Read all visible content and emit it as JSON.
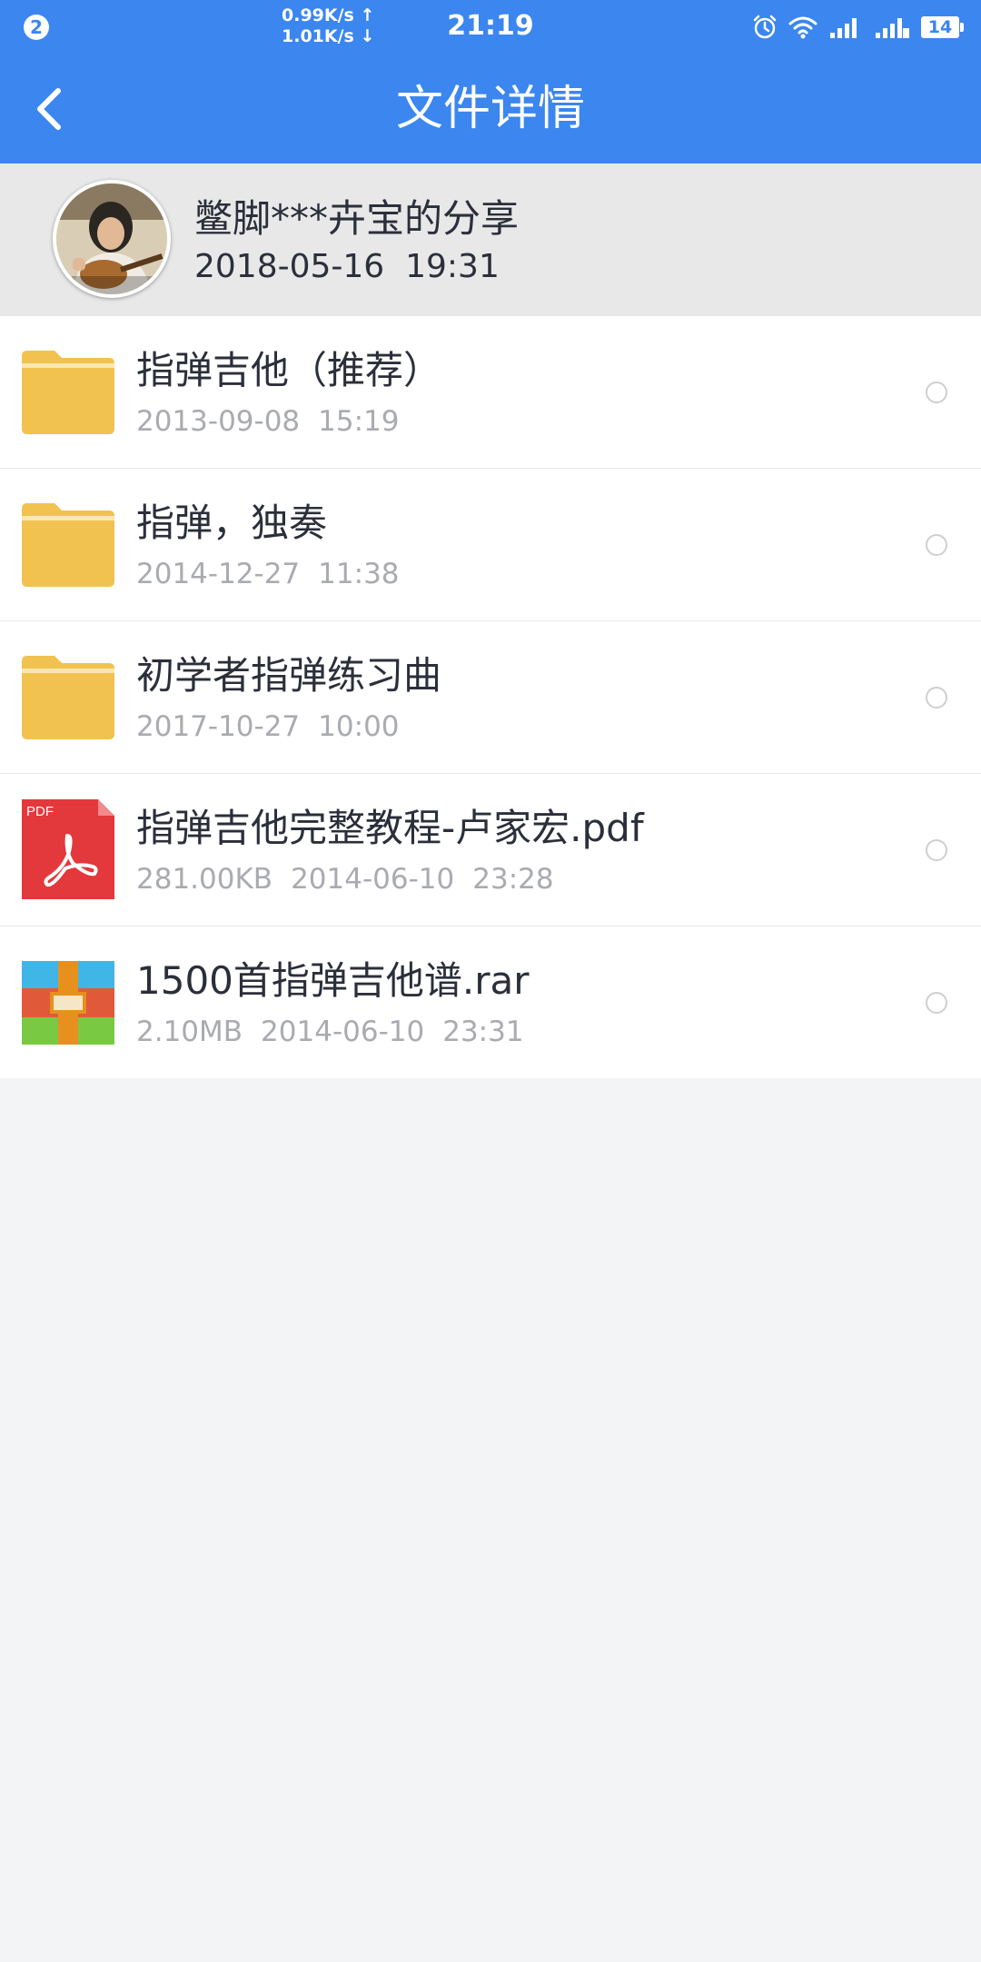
{
  "status_bar": {
    "notification_count": "2",
    "upload_speed": "0.99K/s",
    "download_speed": "1.01K/s",
    "time": "21:19",
    "battery": "14",
    "icons": [
      "alarm-icon",
      "wifi-icon",
      "signal-icon",
      "signal-2-icon",
      "battery-icon"
    ]
  },
  "app_bar": {
    "title": "文件详情",
    "back_icon": "back-arrow-icon"
  },
  "share": {
    "title": "鳖脚***卉宝的分享",
    "date": "2018-05-16",
    "time": "19:31"
  },
  "files": [
    {
      "name": "指弹吉他（推荐）",
      "type": "folder",
      "size": "",
      "date": "2013-09-08",
      "time": "15:19"
    },
    {
      "name": "指弹，独奏",
      "type": "folder",
      "size": "",
      "date": "2014-12-27",
      "time": "11:38"
    },
    {
      "name": "初学者指弹练习曲",
      "type": "folder",
      "size": "",
      "date": "2017-10-27",
      "time": "10:00"
    },
    {
      "name": "指弹吉他完整教程-卢家宏.pdf",
      "type": "pdf",
      "icon_label": "PDF",
      "size": "281.00KB",
      "date": "2014-06-10",
      "time": "23:28"
    },
    {
      "name": "1500首指弹吉他谱.rar",
      "type": "rar",
      "size": "2.10MB",
      "date": "2014-06-10",
      "time": "23:31"
    }
  ],
  "colors": {
    "accent": "#3b86ef",
    "folder": "#f1c24f",
    "pdf": "#e3383c",
    "text_primary": "#2b2f3a",
    "text_secondary": "#a9abb0",
    "background": "#f3f4f6"
  }
}
